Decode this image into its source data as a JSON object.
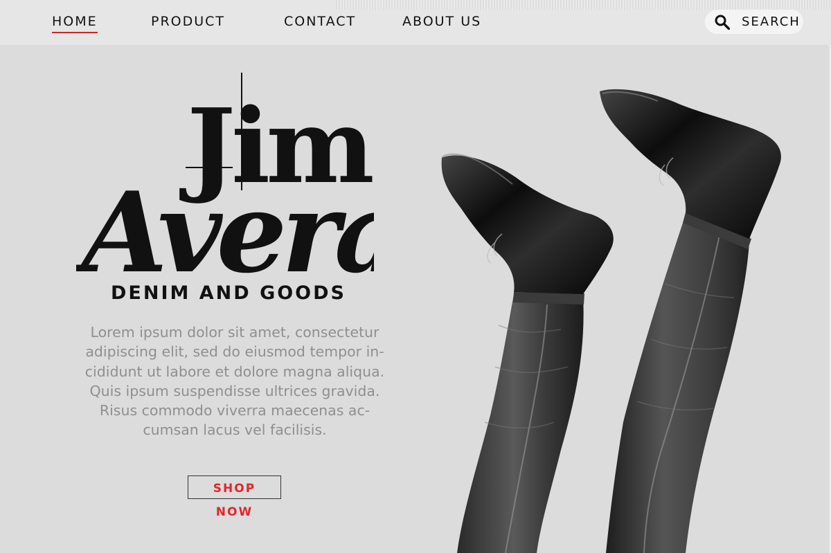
{
  "nav": {
    "items": [
      {
        "label": "HOME",
        "active": true
      },
      {
        "label": "PRODUCT",
        "active": false
      },
      {
        "label": "CONTACT",
        "active": false
      },
      {
        "label": "ABOUT US",
        "active": false
      }
    ],
    "search_label": "SEARCH",
    "search_icon": "search-icon"
  },
  "hero": {
    "logo_line1": "Jim",
    "logo_line2": "Avera",
    "tagline": "DENIM AND GOODS",
    "description_lines": [
      "Lorem ipsum dolor sit amet, consectetur",
      "adipiscing elit, sed do eiusmod tempor in-",
      "cididunt ut labore et dolore magna aliqua.",
      "Quis ipsum suspendisse ultrices gravida.",
      "Risus commodo viverra maecenas ac-",
      "cumsan lacus vel facilisis."
    ],
    "cta_label": "SHOP NOW"
  },
  "colors": {
    "background": "#dcdcdc",
    "topbar": "#e6e6e6",
    "accent": "#e5262b",
    "underline": "#c8262c",
    "text": "#111111",
    "muted_text": "#8f8f8f"
  }
}
